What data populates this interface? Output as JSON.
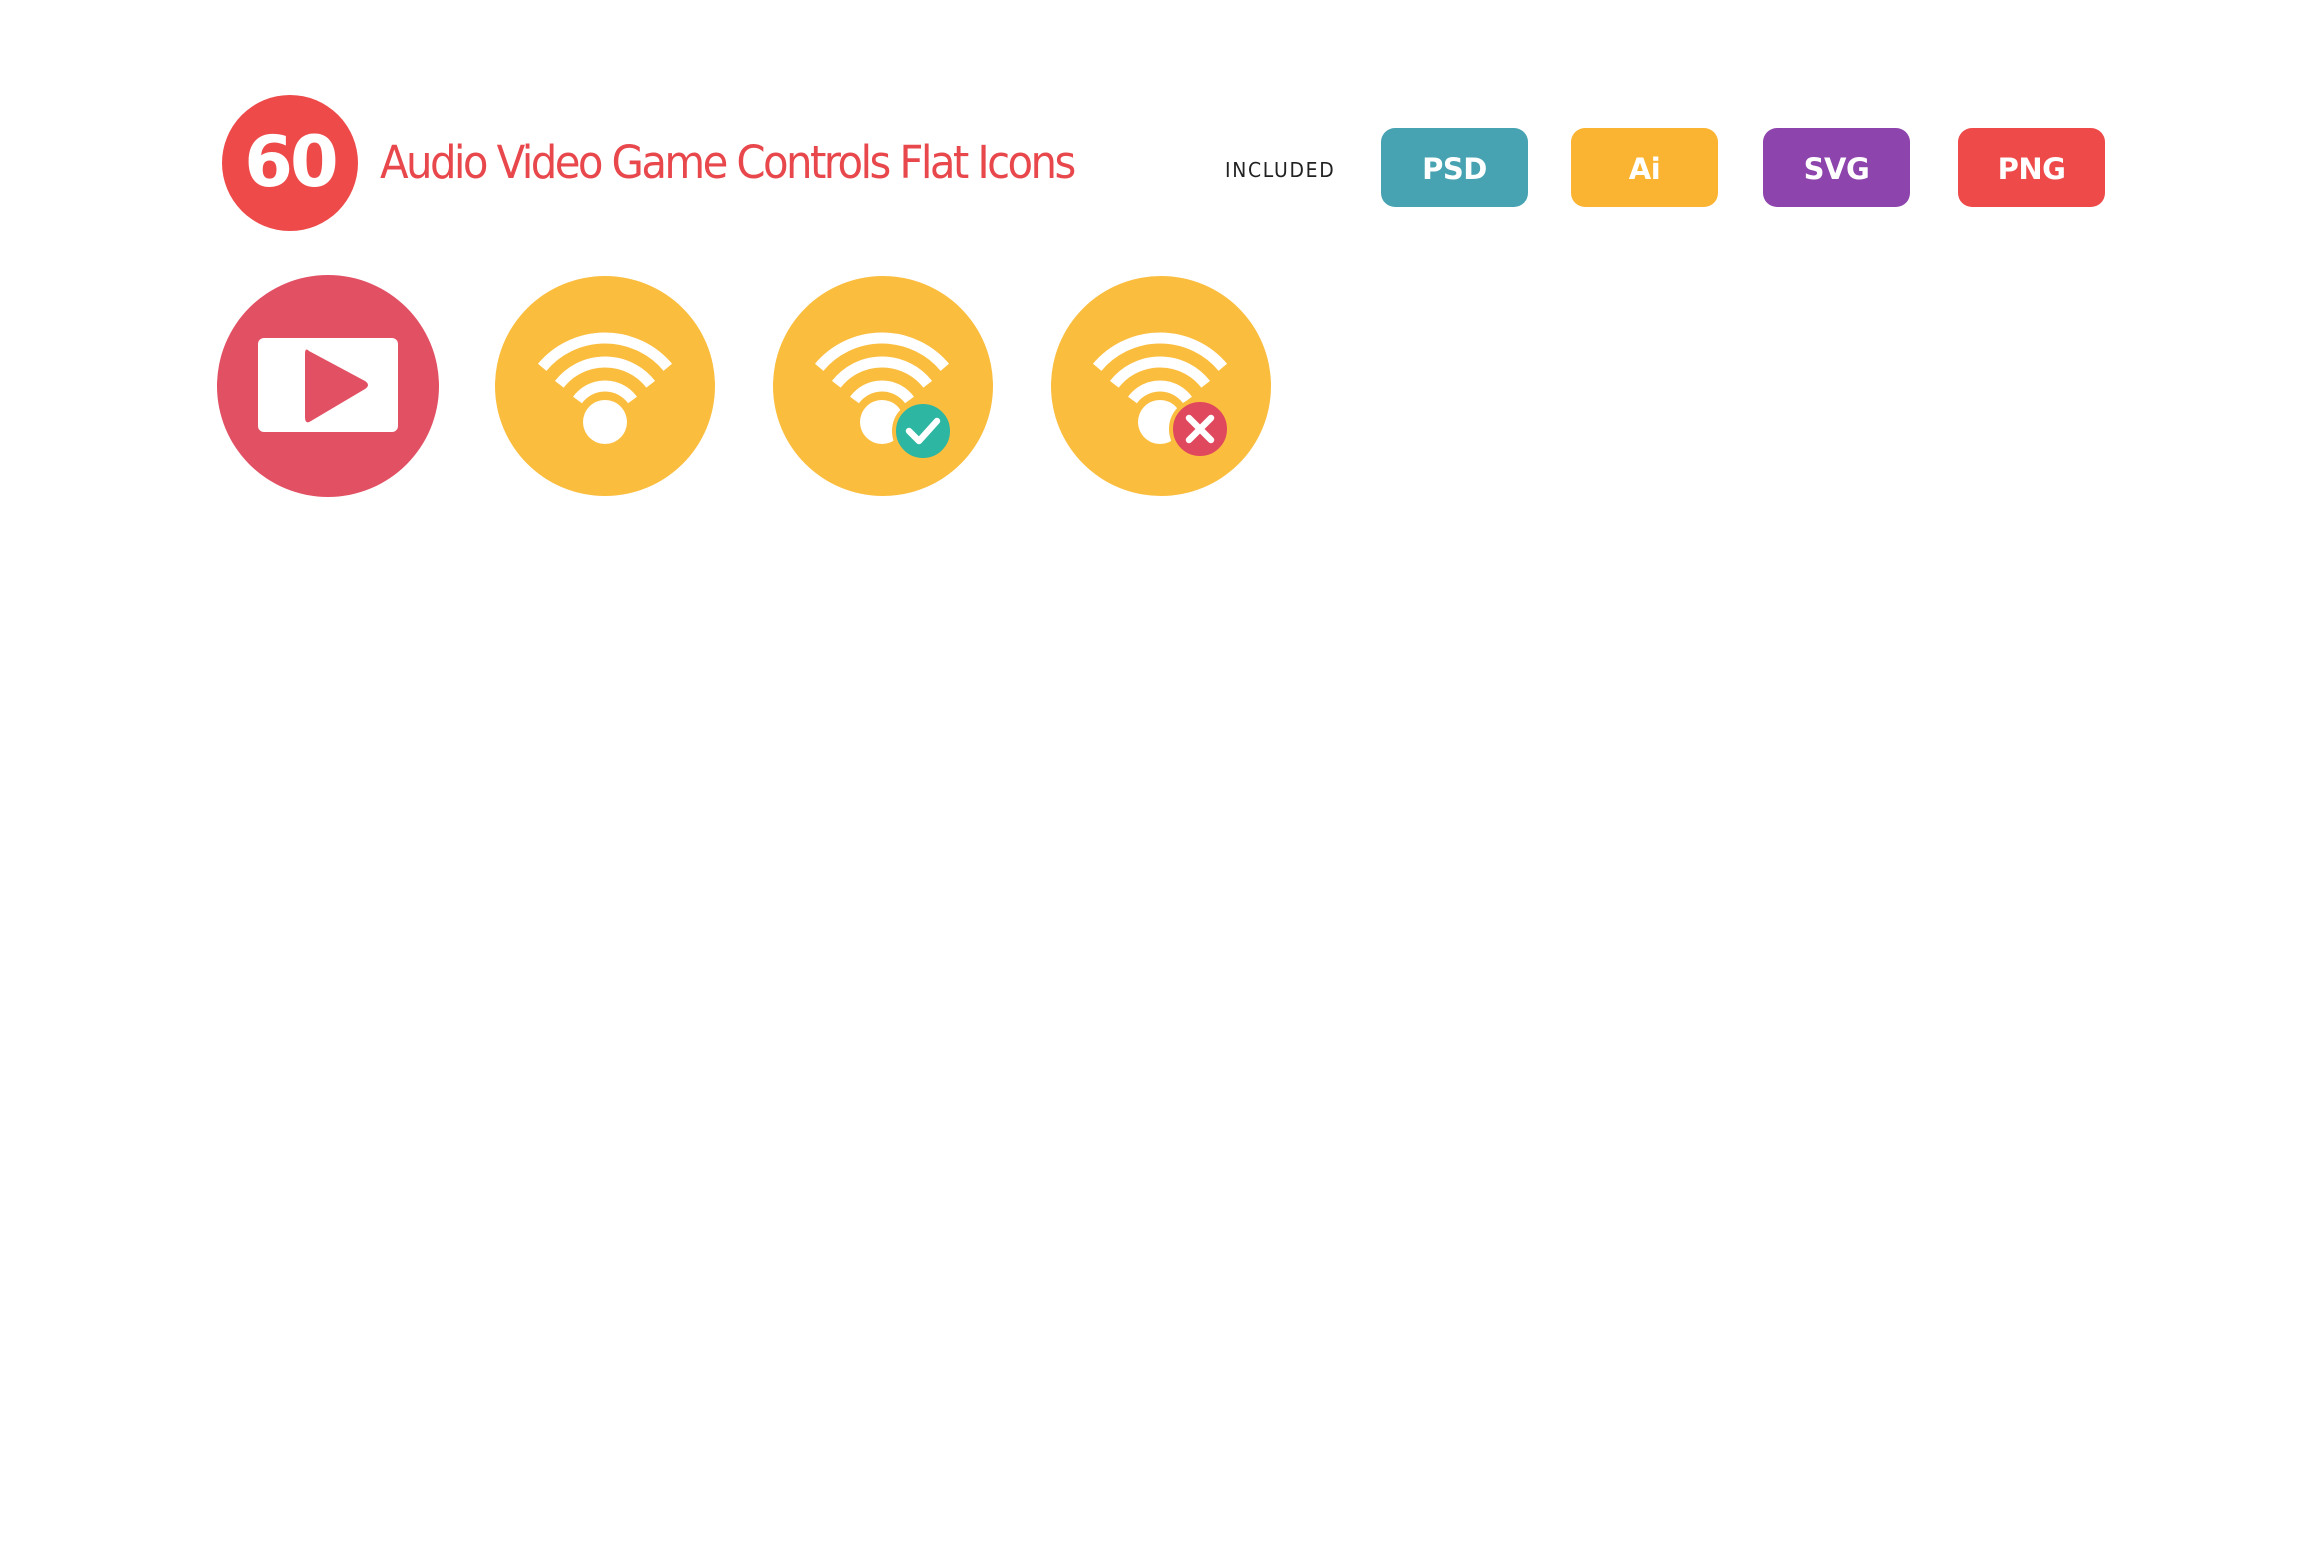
{
  "header": {
    "count": "60",
    "title": "Audio Video Game Controls Flat Icons",
    "included_label": "INCLUDED",
    "formats": [
      {
        "label": "PSD",
        "color": "#47A3B2"
      },
      {
        "label": "Ai",
        "color": "#FBB432"
      },
      {
        "label": "SVG",
        "color": "#8E44AD"
      },
      {
        "label": "PNG",
        "color": "#EF4A4A"
      }
    ]
  },
  "colors": {
    "accent_red": "#EF4A4A",
    "title_red": "#E8474C",
    "video_red": "#E25064",
    "wifi_yellow": "#FBBD3E",
    "success_green": "#2DB6A1",
    "error_red": "#E0485E",
    "glyph_white": "#FFFFFF"
  },
  "icons": [
    {
      "name": "video-play",
      "icon": "video-play-icon",
      "bg": "#E25064"
    },
    {
      "name": "wifi",
      "icon": "wifi-icon",
      "bg": "#FBBD3E"
    },
    {
      "name": "wifi-connected",
      "icon": "wifi-check-icon",
      "bg": "#FBBD3E",
      "status": "check"
    },
    {
      "name": "wifi-disconnected",
      "icon": "wifi-x-icon",
      "bg": "#FBBD3E",
      "status": "x"
    }
  ]
}
